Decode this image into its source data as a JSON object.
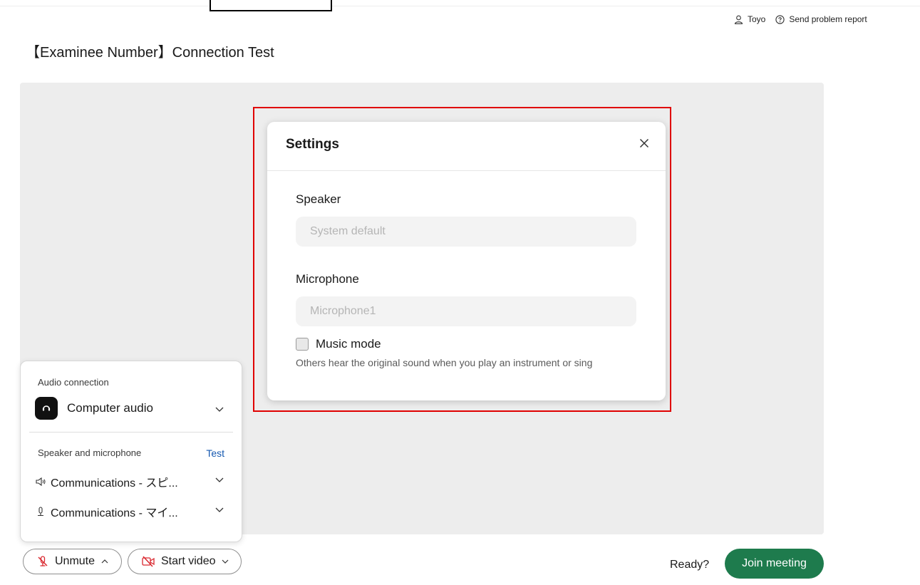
{
  "header": {
    "user_name": "Toyo",
    "report_label": "Send problem report"
  },
  "page": {
    "title": "【Examinee Number】Connection Test"
  },
  "settings": {
    "title": "Settings",
    "speaker_label": "Speaker",
    "speaker_value": "System default",
    "microphone_label": "Microphone",
    "microphone_value": "Microphone1",
    "music_mode_label": "Music mode",
    "music_mode_checked": false,
    "music_mode_desc": "Others hear the original sound when you play an instrument or sing"
  },
  "audio_panel": {
    "connection_heading": "Audio connection",
    "connection_value": "Computer audio",
    "devices_heading": "Speaker and microphone",
    "test_label": "Test",
    "speaker_device": "Communications - スピ...",
    "mic_device": "Communications - マイ..."
  },
  "footer": {
    "unmute_label": "Unmute",
    "start_video_label": "Start video",
    "ready_label": "Ready?",
    "join_label": "Join meeting"
  },
  "colors": {
    "join_button": "#1e7b4d",
    "highlight_border": "#e00000",
    "test_link": "#1558b0",
    "muted_icon": "#d9272e"
  }
}
